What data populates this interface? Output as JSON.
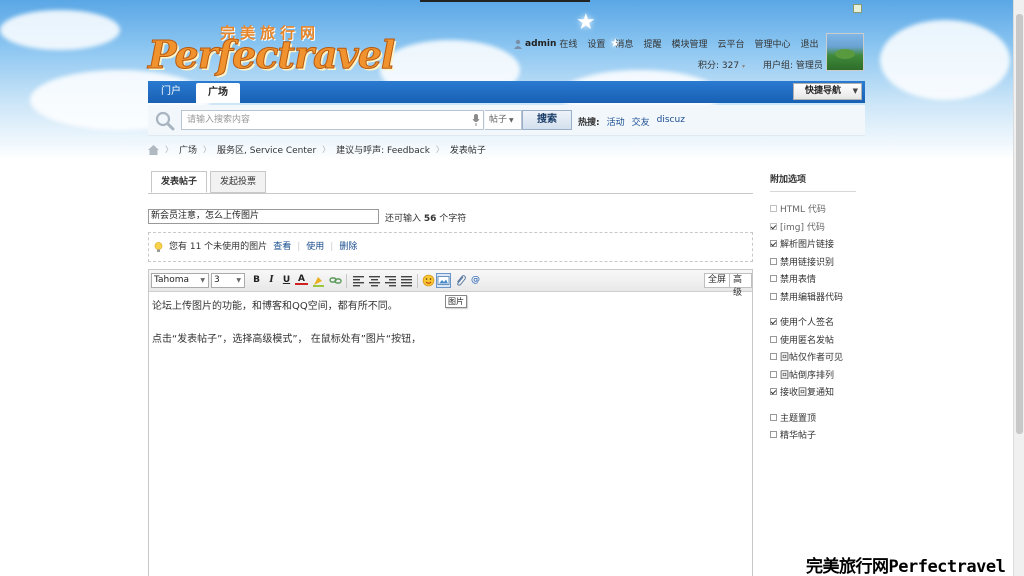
{
  "logo": {
    "cn": "完美旅行网",
    "en": "Perfectravel"
  },
  "user": {
    "name": "admin",
    "status": "在线",
    "links": [
      "设置",
      "消息",
      "提醒",
      "模块管理",
      "云平台",
      "管理中心",
      "退出"
    ],
    "points_label": "积分: 327",
    "group_label": "用户组: 管理员"
  },
  "nav": {
    "items": [
      "门户",
      "广场"
    ],
    "quick_nav": "快捷导航"
  },
  "search": {
    "placeholder": "请输入搜索内容",
    "type": "帖子",
    "button": "搜索",
    "hot_label": "热搜:",
    "hot_links": [
      "活动",
      "交友",
      "discuz"
    ]
  },
  "breadcrumb": [
    "广场",
    "服务区, Service Center",
    "建议与呼声: Feedback",
    "发表帖子"
  ],
  "tabs": [
    "发表帖子",
    "发起投票"
  ],
  "post": {
    "title_value": "新会员注意，怎么上传图片",
    "remain_prefix": "还可输入",
    "remain_count": "56",
    "remain_suffix": "个字符"
  },
  "attachments": {
    "text": "您有 11 个未使用的图片",
    "view": "查看",
    "use": "使用",
    "delete": "删除"
  },
  "editor": {
    "font": "Tahoma",
    "size": "3",
    "fullscreen": "全屏",
    "advanced": "高级",
    "tooltip": "图片",
    "lines": [
      "论坛上传图片的功能，和博客和QQ空间，都有所不同。",
      "点击“发表帖子”，选择高级模式”， 在鼠标处有”图片“按钮，"
    ]
  },
  "sidebar": {
    "title": "附加选项",
    "group1": [
      {
        "label": "HTML 代码",
        "checked": false,
        "disabled": true
      },
      {
        "label": "[img] 代码",
        "checked": true,
        "disabled": true
      },
      {
        "label": "解析图片链接",
        "checked": true,
        "disabled": false
      },
      {
        "label": "禁用链接识别",
        "checked": false,
        "disabled": false
      },
      {
        "label": "禁用表情",
        "checked": false,
        "disabled": false
      },
      {
        "label": "禁用编辑器代码",
        "checked": false,
        "disabled": false
      }
    ],
    "group2": [
      {
        "label": "使用个人签名",
        "checked": true,
        "disabled": false
      },
      {
        "label": "使用匿名发帖",
        "checked": false,
        "disabled": false
      },
      {
        "label": "回帖仅作者可见",
        "checked": false,
        "disabled": false
      },
      {
        "label": "回帖倒序排列",
        "checked": false,
        "disabled": false
      },
      {
        "label": "接收回复通知",
        "checked": true,
        "disabled": false
      }
    ],
    "group3": [
      {
        "label": "主题置顶",
        "checked": false,
        "disabled": false
      },
      {
        "label": "精华帖子",
        "checked": false,
        "disabled": false
      }
    ]
  },
  "watermark": "完美旅行网Perfectravel",
  "colors": {
    "nav_blue": "#1f6cc4",
    "link_blue": "#1a4d8f",
    "logo_orange": "#f0922e"
  }
}
